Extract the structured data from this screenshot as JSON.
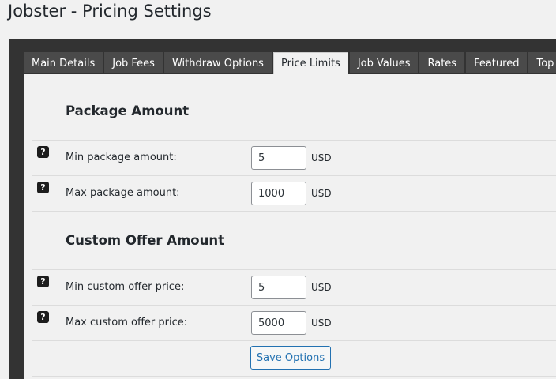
{
  "page": {
    "title": "Jobster - Pricing Settings"
  },
  "tabs": [
    {
      "label": "Main Details"
    },
    {
      "label": "Job Fees"
    },
    {
      "label": "Withdraw Options"
    },
    {
      "label": "Price Limits",
      "active": true
    },
    {
      "label": "Job Values"
    },
    {
      "label": "Rates"
    },
    {
      "label": "Featured"
    },
    {
      "label": "Top Up"
    }
  ],
  "package_section": {
    "title": "Package Amount",
    "rows": [
      {
        "label": "Min package amount:",
        "value": "5",
        "unit": "USD"
      },
      {
        "label": "Max package amount:",
        "value": "1000",
        "unit": "USD"
      }
    ]
  },
  "custom_section": {
    "title": "Custom Offer Amount",
    "rows": [
      {
        "label": "Min custom offer price:",
        "value": "5",
        "unit": "USD"
      },
      {
        "label": "Max custom offer price:",
        "value": "5000",
        "unit": "USD"
      }
    ]
  },
  "actions": {
    "save_label": "Save Options"
  },
  "help_icon": "question-mark-icon"
}
